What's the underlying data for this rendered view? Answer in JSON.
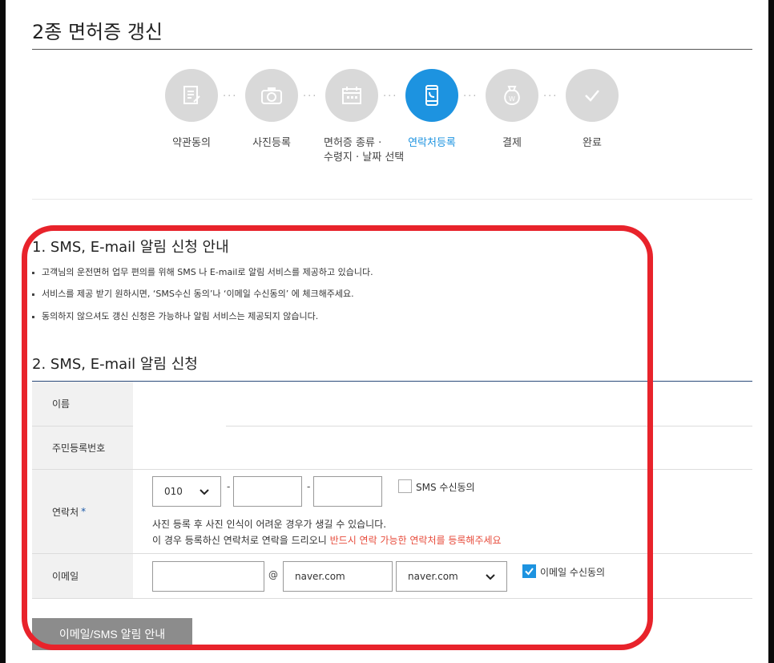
{
  "page_title": "2종 면허증 갱신",
  "steps": [
    {
      "label_1": "약관동의",
      "label_2": "",
      "icon": "document-icon",
      "active": false
    },
    {
      "label_1": "사진등록",
      "label_2": "",
      "icon": "camera-icon",
      "active": false
    },
    {
      "label_1": "면허증 종류 ·",
      "label_2": "수령지 · 날짜 선택",
      "icon": "calendar-icon",
      "active": false
    },
    {
      "label_1": "연락처등록",
      "label_2": "",
      "icon": "phone-icon",
      "active": true
    },
    {
      "label_1": "결제",
      "label_2": "",
      "icon": "won-pouch-icon",
      "active": false
    },
    {
      "label_1": "완료",
      "label_2": "",
      "icon": "check-icon",
      "active": false
    }
  ],
  "section1": {
    "heading": "1. SMS, E-mail 알림 신청 안내",
    "bullets": [
      "고객님의 운전면허 업무 편의를 위해 SMS 나 E-mail로 알림 서비스를 제공하고 있습니다.",
      "서비스를 제공 받기 원하시면, ‘SMS수신 동의’나 ‘이메일 수신동의’ 에 체크해주세요.",
      "동의하지 않으셔도 갱신 신청은 가능하나 알림 서비스는 제공되지 않습니다."
    ]
  },
  "section2": {
    "heading": "2. SMS, E-mail 알림 신청",
    "name_label": "이름",
    "rrn_label": "주민등록번호",
    "phone_label": "연락처",
    "required_mark": "*",
    "phone_prefix": "010",
    "dash": "-",
    "sms_consent_label": "SMS 수신동의",
    "sms_consent_checked": false,
    "note_line1": "사진 등록 후 사진 인식이 어려운 경우가 생길 수 있습니다.",
    "note_line2": "이 경우 등록하신 연락처로 연락을 드리오니 ",
    "note_line2_red": "반드시 연락 가능한 연락처를 등록해주세요",
    "email_label": "이메일",
    "at": "@",
    "email_domain": "naver.com",
    "email_domain_select": "naver.com",
    "email_consent_label": "이메일 수신동의",
    "email_consent_checked": true
  },
  "button_label": "이메일/SMS 알림 안내",
  "colors": {
    "accent": "#1d93e0",
    "highlight": "#e8232b",
    "warning": "#e74c3c"
  }
}
